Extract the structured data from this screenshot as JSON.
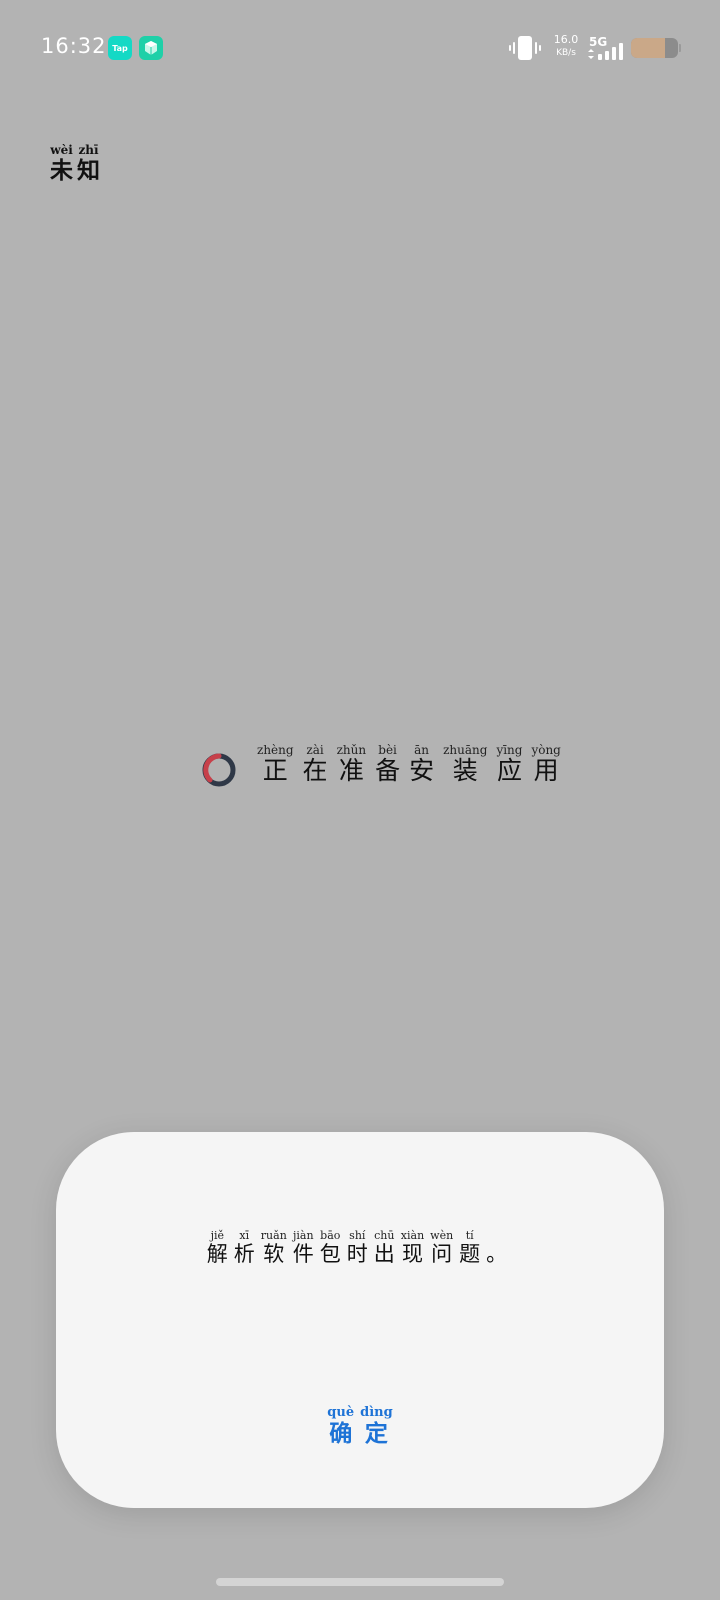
{
  "status_bar": {
    "time": "16:32",
    "app_icons": [
      {
        "name": "tap-icon",
        "label": "Tap",
        "color": "#14d9c5"
      },
      {
        "name": "gem-icon",
        "color": "#1fd0a8"
      }
    ],
    "vibrate_icon": "vibrate-icon",
    "net_speed_value": "16.0",
    "net_speed_unit": "KB/s",
    "network_type": "5G",
    "signal_icon": "signal-icon",
    "battery_level": 0.72,
    "battery_color": "#caa888"
  },
  "app_label": {
    "chars": [
      {
        "char": "未",
        "pinyin": "wèi"
      },
      {
        "char": "知",
        "pinyin": "zhī"
      }
    ]
  },
  "loading": {
    "spinner_icon": "loading-spinner-icon",
    "spinner_colors": {
      "track": "#2f3847",
      "accent": "#c7404a"
    },
    "chars": [
      {
        "char": "正",
        "pinyin": "zhèng"
      },
      {
        "char": "在",
        "pinyin": "zài"
      },
      {
        "char": "准",
        "pinyin": "zhǔn"
      },
      {
        "char": "备",
        "pinyin": "bèi"
      },
      {
        "char": "安",
        "pinyin": "ān"
      },
      {
        "char": "装",
        "pinyin": "zhuāng"
      },
      {
        "char": "应",
        "pinyin": "yīng"
      },
      {
        "char": "用",
        "pinyin": "yòng"
      }
    ]
  },
  "dialog": {
    "message_chars": [
      {
        "char": "解",
        "pinyin": "jiě"
      },
      {
        "char": "析",
        "pinyin": "xī"
      },
      {
        "char": "软",
        "pinyin": "ruǎn"
      },
      {
        "char": "件",
        "pinyin": "jiàn"
      },
      {
        "char": "包",
        "pinyin": "bāo"
      },
      {
        "char": "时",
        "pinyin": "shí"
      },
      {
        "char": "出",
        "pinyin": "chū"
      },
      {
        "char": "现",
        "pinyin": "xiàn"
      },
      {
        "char": "问",
        "pinyin": "wèn"
      },
      {
        "char": "题",
        "pinyin": "tí"
      },
      {
        "char": "。",
        "pinyin": ""
      }
    ],
    "confirm_chars": [
      {
        "char": "确",
        "pinyin": "què"
      },
      {
        "char": "定",
        "pinyin": "dìng"
      }
    ],
    "accent_color": "#1e73d6"
  }
}
